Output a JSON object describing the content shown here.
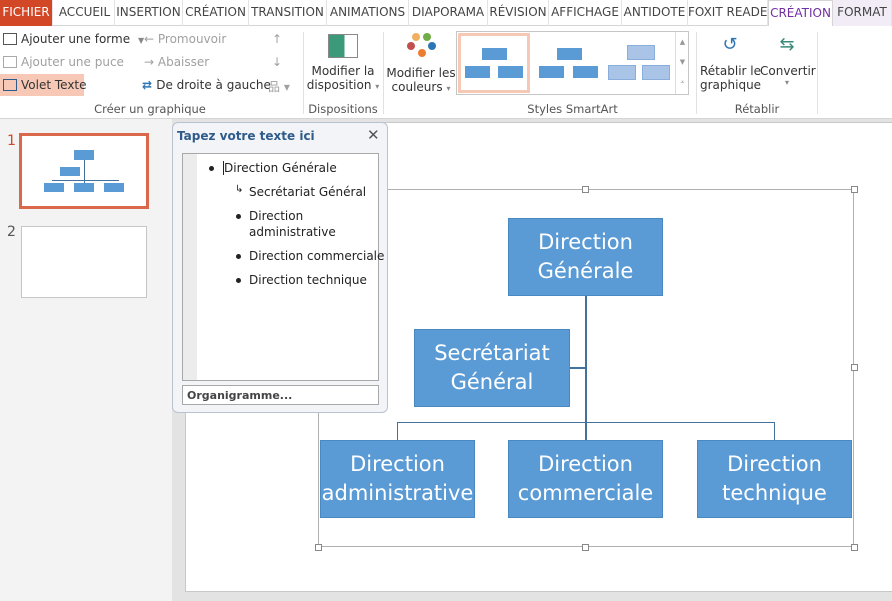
{
  "tabs": [
    {
      "label": "FICHIER"
    },
    {
      "label": "ACCUEIL"
    },
    {
      "label": "INSERTION"
    },
    {
      "label": "CRÉATION"
    },
    {
      "label": "TRANSITION"
    },
    {
      "label": "ANIMATIONS"
    },
    {
      "label": "DIAPORAMA"
    },
    {
      "label": "RÉVISION"
    },
    {
      "label": "AFFICHAGE"
    },
    {
      "label": "ANTIDOTE"
    },
    {
      "label": "FOXIT READE"
    },
    {
      "label": "CRÉATION"
    },
    {
      "label": "FORMAT"
    }
  ],
  "ribbon": {
    "add_shape": "Ajouter une forme",
    "add_bullet": "Ajouter une puce",
    "text_pane": "Volet Texte",
    "promote": "Promouvoir",
    "demote": "Abaisser",
    "rtl": "De droite à gauche",
    "group_create": "Créer un graphique",
    "change_layout_1": "Modifier la",
    "change_layout_2": "disposition",
    "group_layouts": "Dispositions",
    "change_colors_1": "Modifier les",
    "change_colors_2": "couleurs",
    "group_styles": "Styles SmartArt",
    "reset_1": "Rétablir le",
    "reset_2": "graphique",
    "convert": "Convertir",
    "group_reset": "Rétablir"
  },
  "slides": [
    {
      "number": "1"
    },
    {
      "number": "2"
    }
  ],
  "text_pane": {
    "title": "Tapez votre texte ici",
    "items": [
      "Direction Générale",
      "Secrétariat Général",
      "Direction administrative",
      "Direction commerciale",
      "Direction technique"
    ],
    "item2_line1": "Direction",
    "item2_line2": "administrative",
    "footer": "Organigramme..."
  },
  "smartart": {
    "top": "Direction Générale",
    "assistant": "Secrétariat Général",
    "children": [
      "Direction administrative",
      "Direction commerciale",
      "Direction technique"
    ]
  },
  "colors": {
    "file_tab": "#d24726",
    "accent": "#7030a0",
    "box": "#5b9bd5",
    "selected_slide": "#d9694a"
  }
}
